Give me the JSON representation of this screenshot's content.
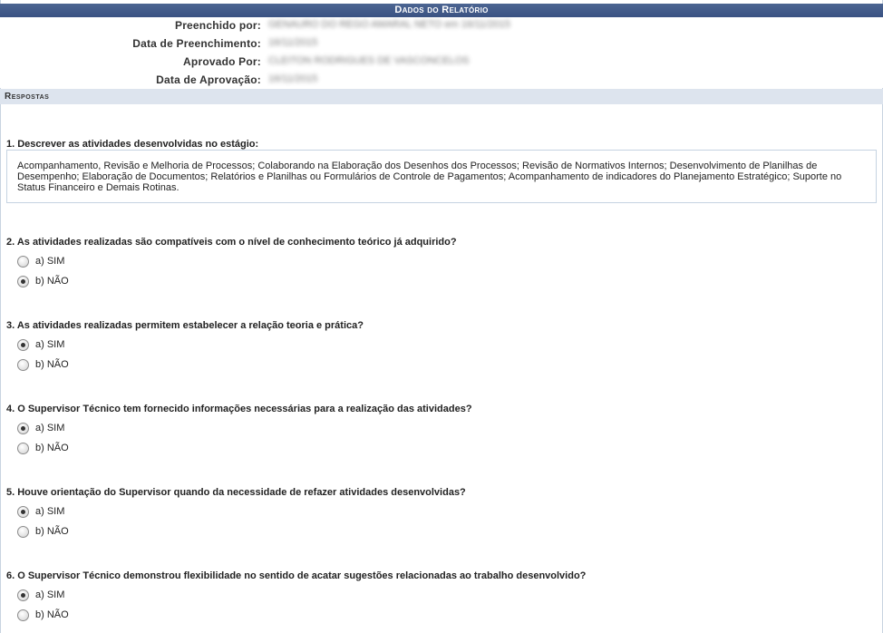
{
  "header": {
    "title": "Dados do Relatório"
  },
  "info": [
    {
      "label": "Preenchido por:",
      "value": "GENAURO DO REGO AMARAL NETO em 16/11/2015"
    },
    {
      "label": "Data de Preenchimento:",
      "value": "16/11/2015"
    },
    {
      "label": "Aprovado Por:",
      "value": "CLEITON RODRIGUES DE VASCONCELOS"
    },
    {
      "label": "Data de Aprovação:",
      "value": "16/11/2015"
    }
  ],
  "section": {
    "title": "Respostas"
  },
  "questions": [
    {
      "text": "1. Descrever as atividades desenvolvidas no estágio:",
      "answer": "Acompanhamento, Revisão e Melhoria de Processos; Colaborando na Elaboração dos Desenhos dos Processos; Revisão de Normativos Internos; Desenvolvimento de Planilhas de Desempenho; Elaboração de Documentos; Relatórios e Planilhas ou Formulários de Controle de Pagamentos; Acompanhamento de indicadores do Planejamento Estratégico; Suporte no Status Financeiro e Demais Rotinas."
    },
    {
      "text": "2. As atividades realizadas são compatíveis com o nível de conhecimento teórico já adquirido?",
      "options": [
        "a) SIM",
        "b) NÃO"
      ],
      "selected": "b) NÃO"
    },
    {
      "text": "3. As atividades realizadas permitem estabelecer a relação teoria e prática?",
      "options": [
        "a) SIM",
        "b) NÃO"
      ],
      "selected": "a) SIM"
    },
    {
      "text": "4. O Supervisor Técnico tem fornecido informações necessárias para a realização das atividades?",
      "options": [
        "a) SIM",
        "b) NÃO"
      ],
      "selected": "a) SIM"
    },
    {
      "text": "5. Houve orientação do Supervisor quando da necessidade de refazer atividades desenvolvidas?",
      "options": [
        "a) SIM",
        "b) NÃO"
      ],
      "selected": "a) SIM"
    },
    {
      "text": "6. O Supervisor Técnico demonstrou flexibilidade no sentido de acatar sugestões relacionadas ao trabalho desenvolvido?",
      "options": [
        "a) SIM",
        "b) NÃO"
      ],
      "selected": "a) SIM"
    }
  ]
}
